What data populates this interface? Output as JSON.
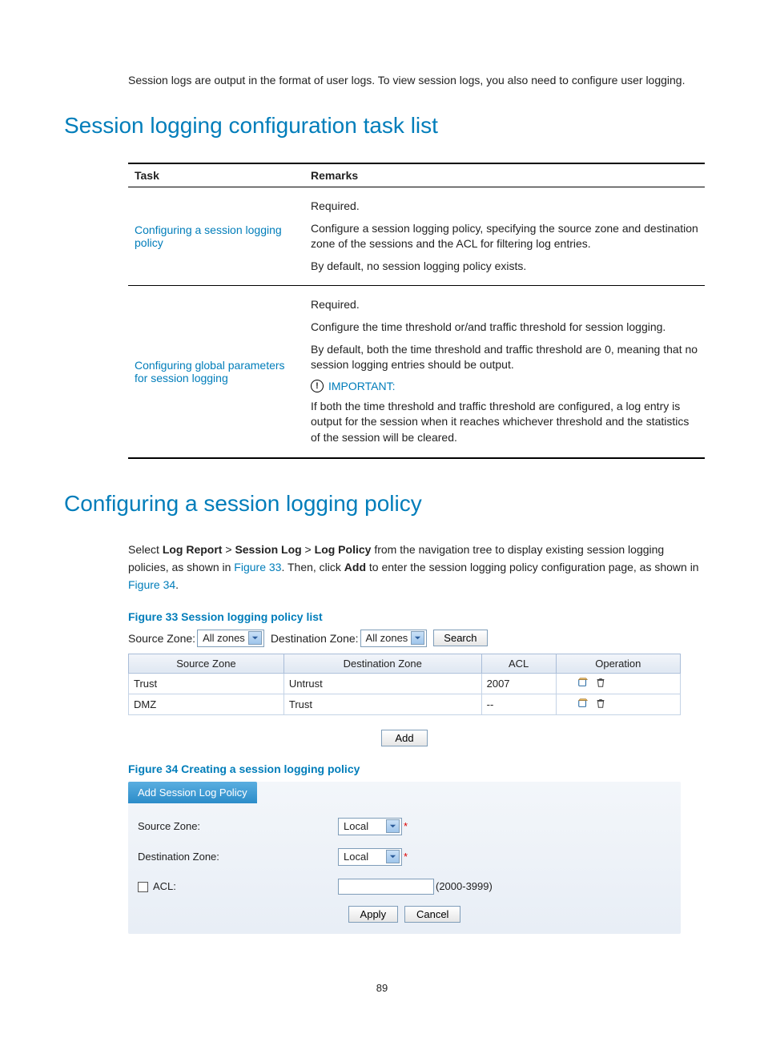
{
  "intro": "Session logs are output in the format of user logs. To view session logs, you also need to configure user logging.",
  "h1a": "Session logging configuration task list",
  "table_headers": {
    "task": "Task",
    "remarks": "Remarks"
  },
  "task1": {
    "link": "Configuring a session logging policy",
    "p1": "Required.",
    "p2": "Configure a session logging policy, specifying the source zone and destination zone of the sessions and the ACL for filtering log entries.",
    "p3": "By default, no session logging policy exists."
  },
  "task2": {
    "link": "Configuring global parameters for session logging",
    "p1": "Required.",
    "p2": "Configure the time threshold or/and traffic threshold for session logging.",
    "p3": "By default, both the time threshold and traffic threshold are 0, meaning that no session logging entries should be output.",
    "important": "IMPORTANT:",
    "p4": "If both the time threshold and traffic threshold are configured, a log entry is output for the session when it reaches whichever threshold and the statistics of the session will be cleared."
  },
  "h1b": "Configuring a session logging policy",
  "body": {
    "pre": "Select ",
    "b1": "Log Report",
    "sep": " > ",
    "b2": "Session Log",
    "b3": "Log Policy",
    "mid": " from the navigation tree to display existing session logging policies, as shown in ",
    "fig33": "Figure 33",
    "mid2": ". Then, click ",
    "b4": "Add",
    "mid3": " to enter the session logging policy configuration page, as shown in ",
    "fig34": "Figure 34",
    "end": "."
  },
  "fig33_caption": "Figure 33 Session logging policy list",
  "fig33": {
    "srcLabel": "Source Zone:",
    "srcSel": "All zones",
    "dstLabel": "Destination Zone:",
    "dstSel": "All zones",
    "search": "Search",
    "cols": {
      "src": "Source Zone",
      "dst": "Destination Zone",
      "acl": "ACL",
      "op": "Operation"
    },
    "rows": [
      {
        "src": "Trust",
        "dst": "Untrust",
        "acl": "2007"
      },
      {
        "src": "DMZ",
        "dst": "Trust",
        "acl": "--"
      }
    ],
    "add": "Add"
  },
  "fig34_caption": "Figure 34 Creating a session logging policy",
  "fig34": {
    "tab": "Add Session Log Policy",
    "srcLabel": "Source Zone:",
    "srcSel": "Local",
    "dstLabel": "Destination Zone:",
    "dstSel": "Local",
    "aclLabel": "ACL:",
    "aclRange": "(2000-3999)",
    "apply": "Apply",
    "cancel": "Cancel"
  },
  "pagenum": "89"
}
